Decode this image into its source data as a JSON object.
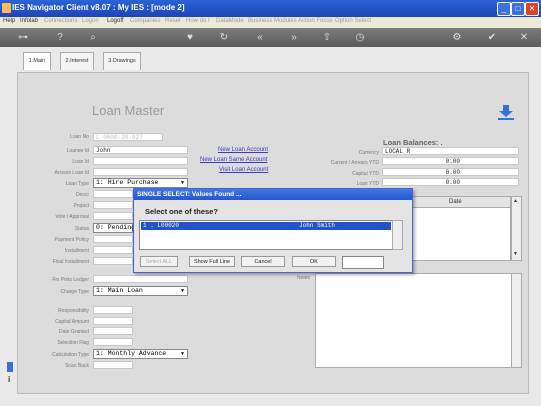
{
  "window": {
    "title": "IES Navigator Client v8.07 : My IES :      [mode 2]",
    "minimize": "_",
    "maximize": "□",
    "close": "✕"
  },
  "menu": [
    {
      "label": "Help",
      "dim": false
    },
    {
      "label": "Infolab",
      "dim": false
    },
    {
      "label": "Connections",
      "dim": true
    },
    {
      "label": "Logon",
      "dim": true
    },
    {
      "label": "Logoff",
      "dim": false
    },
    {
      "label": "Companies",
      "dim": true
    },
    {
      "label": "Reset",
      "dim": true
    },
    {
      "label": "How do I",
      "dim": true
    },
    {
      "label": "DataMode",
      "dim": true
    },
    {
      "label": "Business Modules",
      "dim": true
    },
    {
      "label": "Action Focus",
      "dim": true
    },
    {
      "label": "Option Select",
      "dim": true
    }
  ],
  "toolbar": {
    "icons": [
      "key-icon",
      "help-icon",
      "search-icon",
      "heart-icon",
      "refresh-icon",
      "rewind-icon",
      "forward-icon",
      "upload-icon",
      "clock-icon",
      "settings-icon",
      "check-icon",
      "close-icon"
    ]
  },
  "tabs": [
    {
      "label": "1.Main"
    },
    {
      "label": "2.Interest"
    },
    {
      "label": "3.Drawings"
    }
  ],
  "page": {
    "heading": "Loan Master"
  },
  "form": {
    "loan_no": {
      "label": "Loan No",
      "value": "L-0000-20-027"
    },
    "loanee_id": {
      "label": "Loanee Id",
      "value": "John"
    },
    "loan_id": {
      "label": "Loan Id",
      "value": ""
    },
    "arrears_loan_id": {
      "label": "Arrears Loan Id",
      "value": ""
    },
    "loan_type": {
      "label": "Loan Type",
      "value": "1: Hire Purchase"
    },
    "descr": {
      "label": "Descr",
      "value": ""
    },
    "project": {
      "label": "Project",
      "value": ""
    },
    "vote": {
      "label": "Vote / Approval",
      "value": ""
    },
    "status": {
      "label": "Status",
      "value": "0: Pending"
    },
    "payment_policy": {
      "label": "Payment Policy",
      "value": ""
    },
    "installment": {
      "label": "Installment",
      "value": ""
    },
    "final_installment": {
      "label": "Final Installment",
      "value": ""
    },
    "fin_pmts_ledger": {
      "label": "Fin Pmts Ledger",
      "value": ""
    },
    "charge_type": {
      "label": "Charge Type",
      "value": "1: Main Loan"
    },
    "responsibility": {
      "label": "Responsibility",
      "value": ""
    },
    "capital_amount": {
      "label": "Capital Amount",
      "value": ""
    },
    "date_granted": {
      "label": "Date Granted",
      "value": ""
    },
    "selection_flag": {
      "label": "Selection Flag",
      "value": ""
    },
    "calculation_type": {
      "label": "Calculation Type",
      "value": "1: Monthly Advance"
    },
    "scan_back": {
      "label": "Scan Back",
      "value": ""
    }
  },
  "links": {
    "new_account": "New Loan Account",
    "new_same": "New Loan Same Account",
    "visit": "Visit Loan Account"
  },
  "balances": {
    "title": "Loan Balances: .",
    "currency": {
      "label": "Currency",
      "value": "LOCAL R"
    },
    "current_arrears": {
      "label": "Current / Arrears YTD",
      "value": "0.00"
    },
    "capital_ytd": {
      "label": "Capital YTD",
      "value": "0.00"
    },
    "loan_ytd": {
      "label": "Loan YTD",
      "value": "0.00"
    },
    "date_header": "Date"
  },
  "notes": {
    "label": "Notes"
  },
  "dialog": {
    "title": "SINGLE SELECT: Values Found ...",
    "prompt": "Select one of these?",
    "rows": [
      {
        "id": "1 . L00020",
        "name": "John Smith"
      }
    ],
    "buttons": {
      "select_all": "Select ALL",
      "show_full_line": "Show Full Line",
      "cancel": "Cancel",
      "ok": "OK"
    },
    "input_value": ""
  }
}
